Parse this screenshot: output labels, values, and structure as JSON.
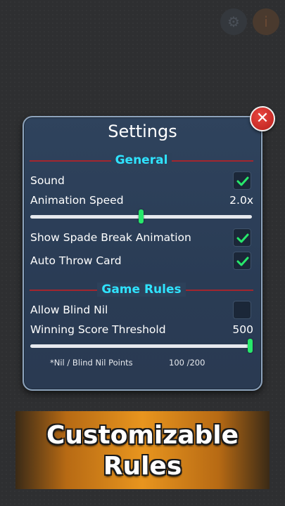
{
  "settings": {
    "title": "Settings",
    "general_header": "General",
    "sound_label": "Sound",
    "sound_checked": true,
    "animation_speed_label": "Animation Speed",
    "animation_speed_value": "2.0x",
    "animation_speed_fraction": 0.5,
    "spade_break_label": "Show Spade Break Animation",
    "spade_break_checked": true,
    "auto_throw_label": "Auto Throw Card",
    "auto_throw_checked": true,
    "game_rules_header": "Game Rules",
    "blind_nil_label": "Allow Blind Nil",
    "blind_nil_checked": false,
    "winning_score_label": "Winning Score Threshold",
    "winning_score_value": "500",
    "winning_score_fraction": 1.0,
    "nil_points_label": "*Nil / Blind Nil Points",
    "nil_points_value": "100 /200"
  },
  "close_icon": "close-x",
  "banner": {
    "line1": "Customizable",
    "line2": "Rules"
  },
  "colors": {
    "accent_cyan": "#2fe3ff",
    "check_green": "#27e86b",
    "divider_red": "#a3262e",
    "close_red": "#d93430"
  }
}
